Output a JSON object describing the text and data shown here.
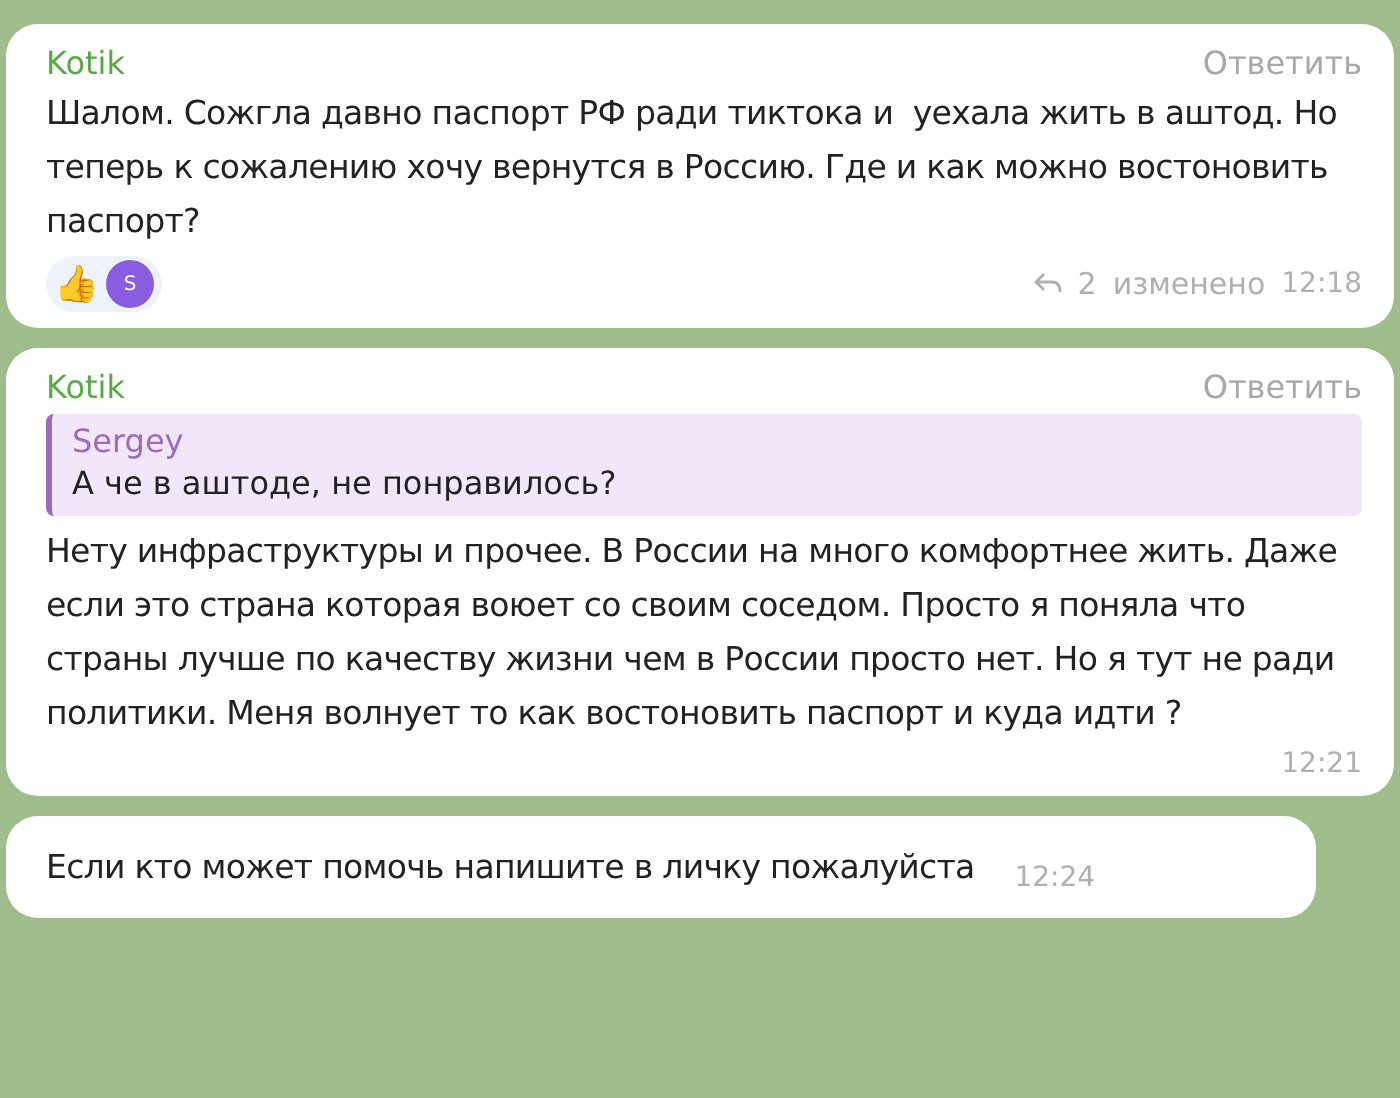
{
  "messages": [
    {
      "kind": "full",
      "author": "Kotik",
      "reply_action": "Ответить",
      "text": "Шалом. Сожгла давно паспорт РФ ради тиктока и  уехала жить в аштод. Но теперь к сожалению хочу вернутся в Россию. Где и как можно востоновить паспорт?",
      "reactions": [
        {
          "kind": "emoji",
          "label": "👍"
        },
        {
          "kind": "avatar",
          "label": "S"
        }
      ],
      "replies_count": "2",
      "edited": "изменено",
      "time": "12:18"
    },
    {
      "kind": "full",
      "author": "Kotik",
      "reply_action": "Ответить",
      "quote": {
        "author": "Sergey",
        "text": "А че в аштоде, не понравилось?"
      },
      "text": "Нету инфраструктуры и прочее. В России на много комфортнее жить. Даже если это страна которая воюет со своим соседом. Просто я поняла что страны лучше по качеству жизни чем в России просто нет. Но я тут не ради политики. Меня волнует то как востоновить паспорт и куда идти ?",
      "time": "12:21"
    },
    {
      "kind": "compact",
      "text": "Если кто может помочь напишите в личку пожалуйста",
      "time": "12:24"
    }
  ]
}
